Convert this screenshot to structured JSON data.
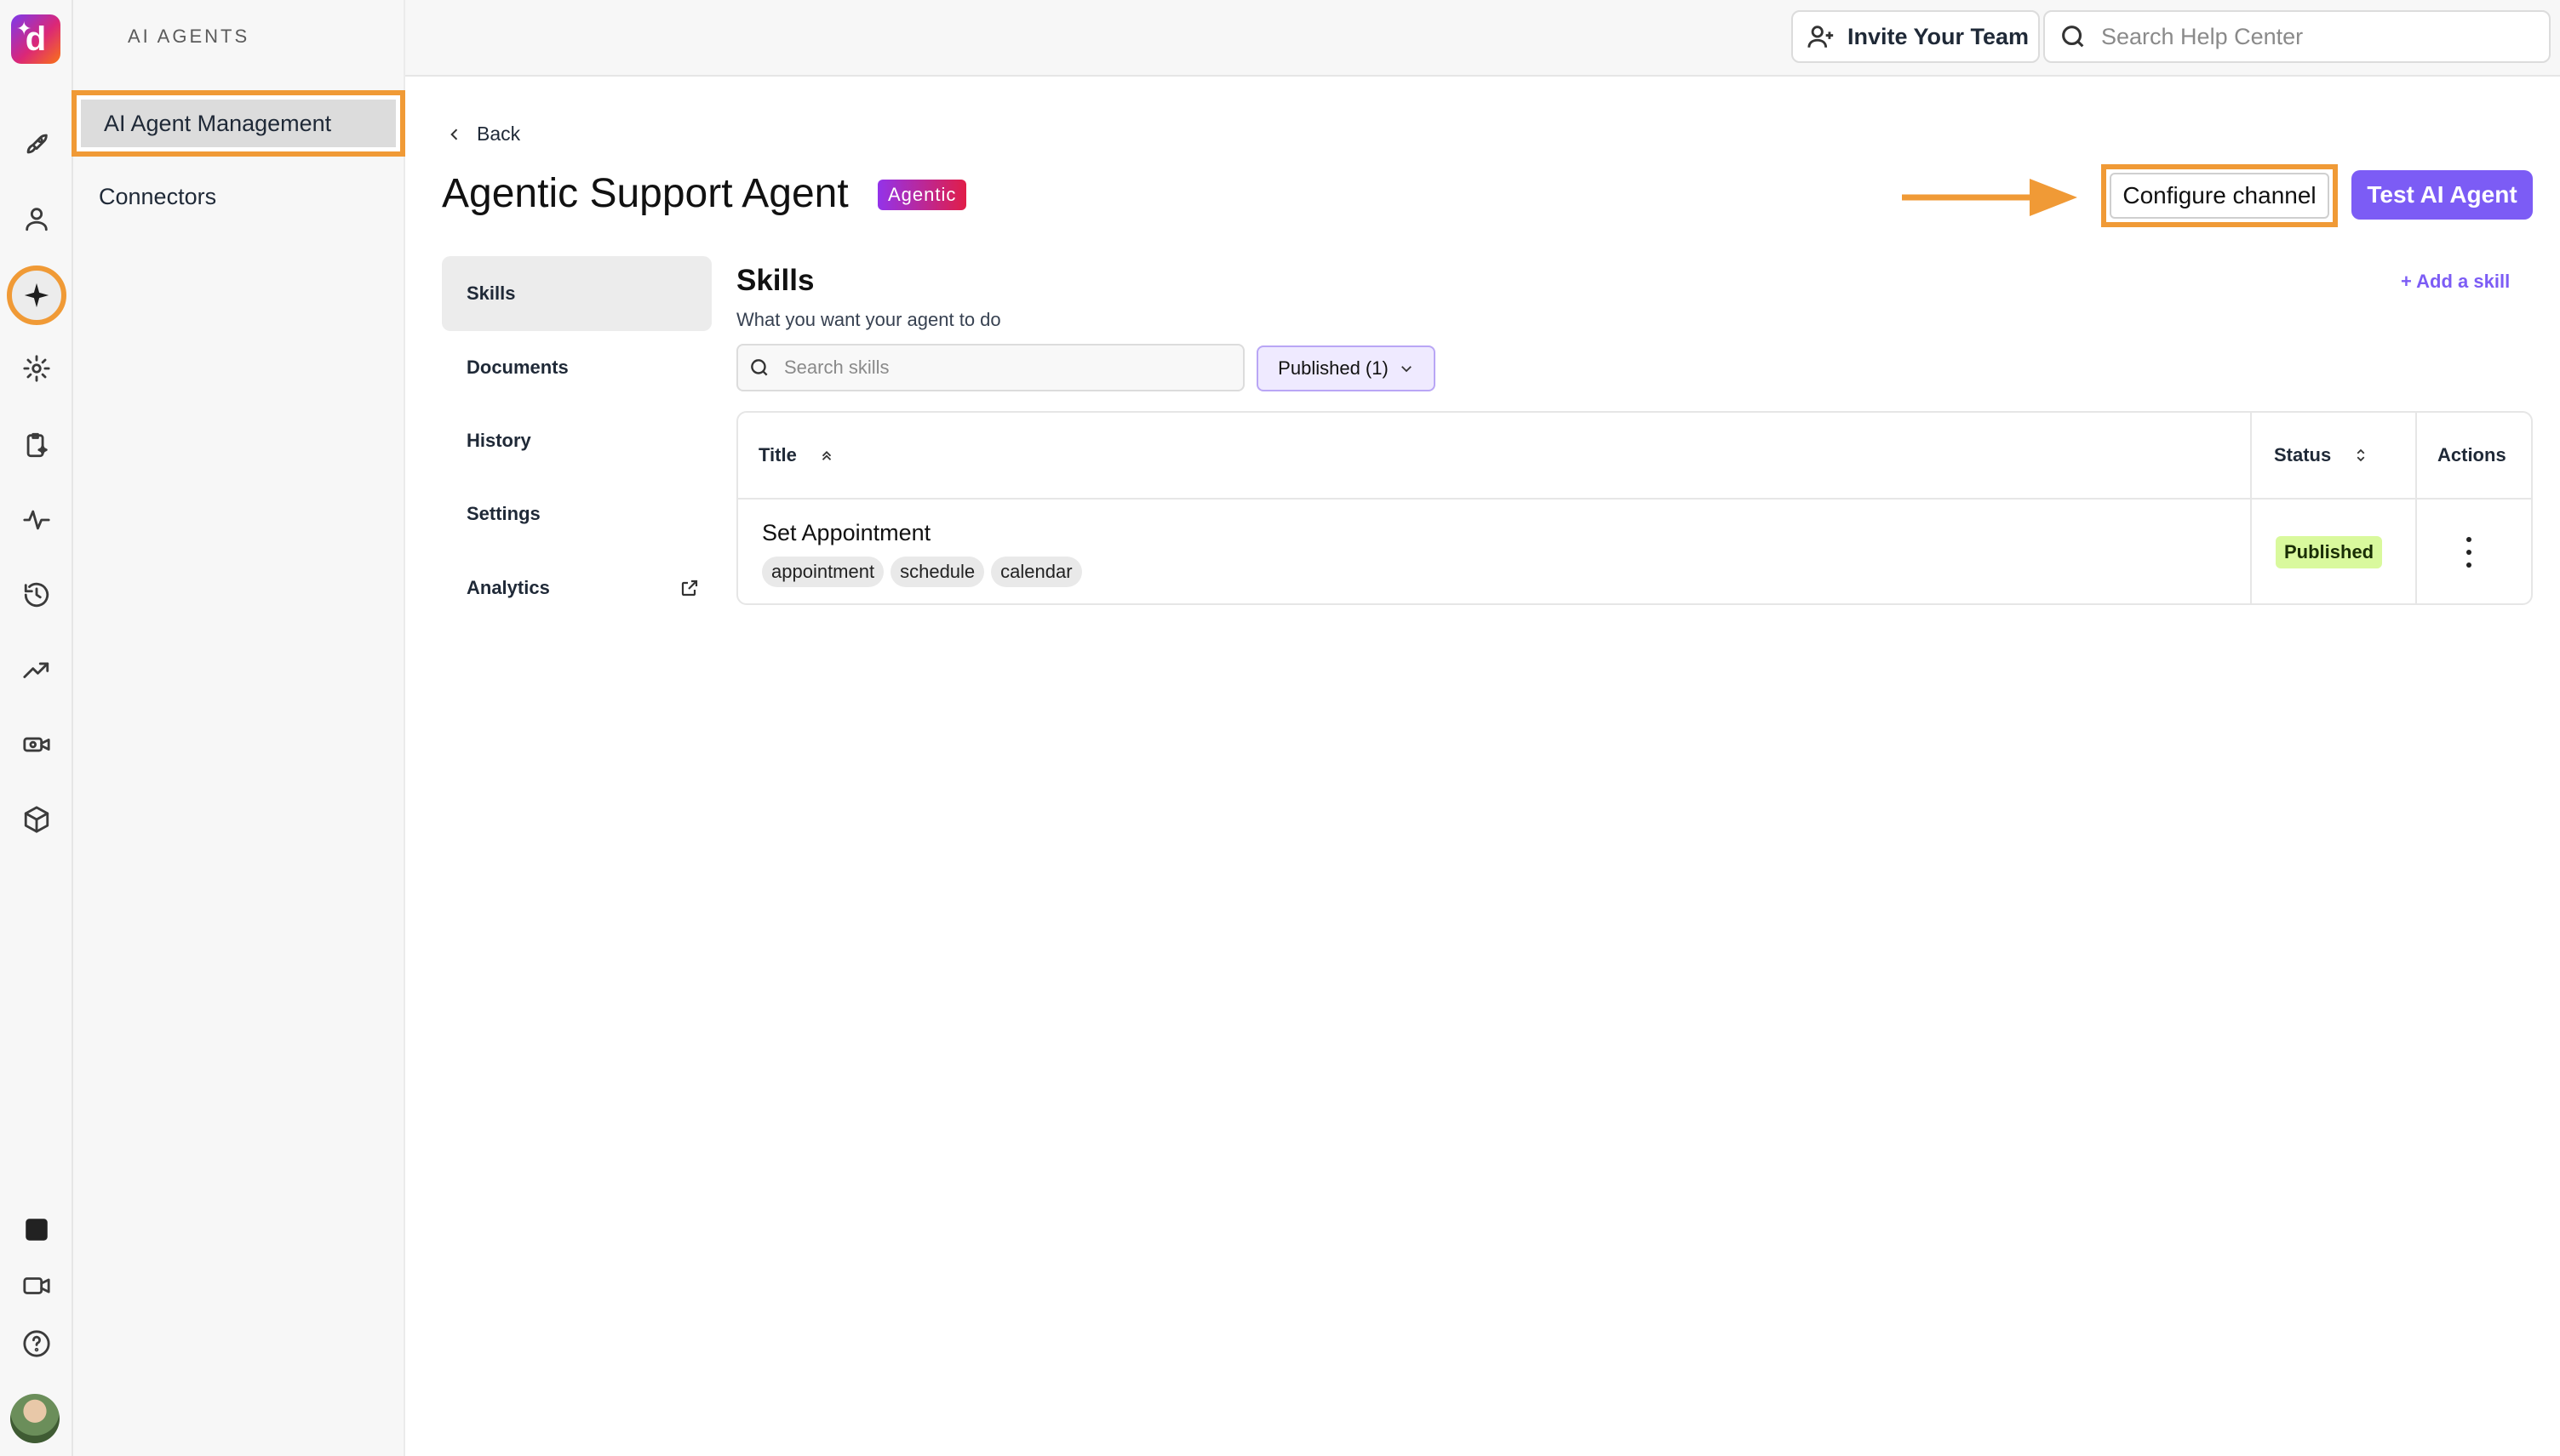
{
  "app": {
    "section": "AI AGENTS",
    "colors": {
      "accent": "#7c5cf5",
      "highlight": "#f09a36",
      "published": "#d9f99d"
    }
  },
  "topbar": {
    "invite_label": "Invite Your Team",
    "help_search_placeholder": "Search Help Center"
  },
  "rail": {
    "icons": [
      "rocket-icon",
      "user-icon",
      "sparkle-icon",
      "gear-icon",
      "clipboard-sparkle-icon",
      "activity-icon",
      "history-icon",
      "trend-icon",
      "video-settings-icon",
      "box-icon",
      "brand-icon",
      "camera-icon",
      "help-icon",
      "avatar"
    ],
    "active": "sparkle-icon"
  },
  "subnav": {
    "items": [
      {
        "label": "AI Agent Management",
        "active": true
      },
      {
        "label": "Connectors",
        "active": false
      }
    ]
  },
  "main": {
    "back_label": "Back",
    "title": "Agentic Support Agent",
    "badge": "Agentic",
    "configure_label": "Configure channel",
    "test_label": "Test AI Agent"
  },
  "inner_nav": {
    "items": [
      {
        "label": "Skills",
        "active": true
      },
      {
        "label": "Documents"
      },
      {
        "label": "History"
      },
      {
        "label": "Settings"
      },
      {
        "label": "Analytics",
        "external": true
      }
    ]
  },
  "skills": {
    "title": "Skills",
    "subtitle": "What you want your agent to do",
    "add_label": "+ Add a skill",
    "search_placeholder": "Search skills",
    "filter_label": "Published (1)",
    "columns": {
      "title": "Title",
      "status": "Status",
      "actions": "Actions"
    },
    "rows": [
      {
        "title": "Set Appointment",
        "tags": [
          "appointment",
          "schedule",
          "calendar"
        ],
        "status": "Published"
      }
    ]
  }
}
